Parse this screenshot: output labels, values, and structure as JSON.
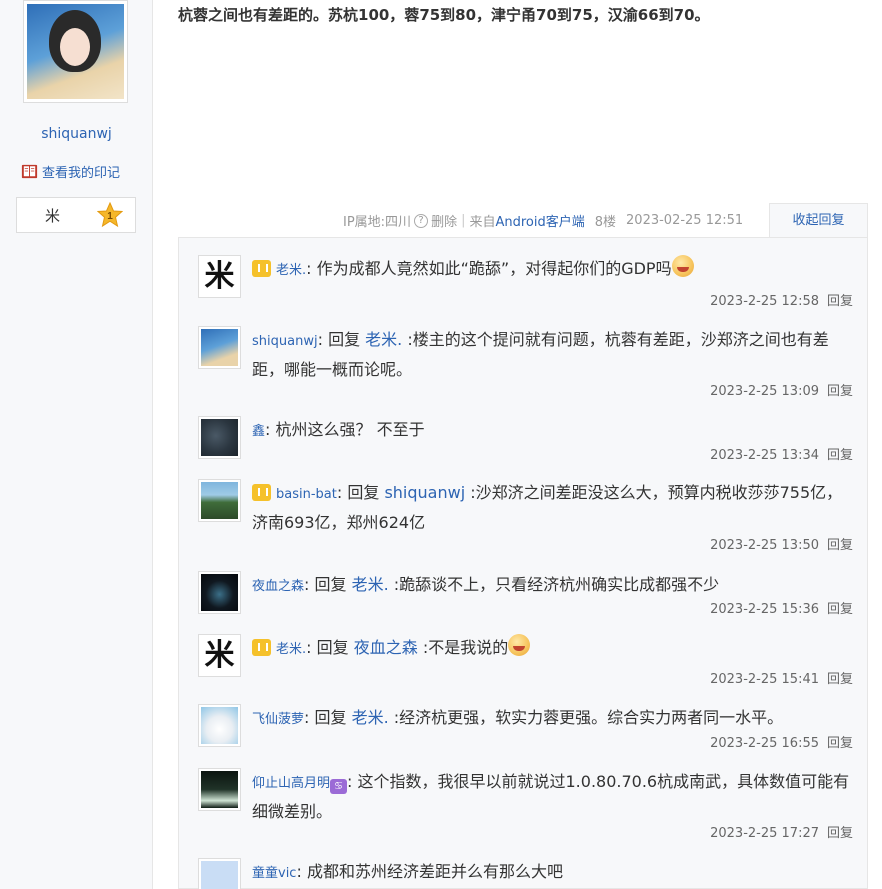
{
  "post": {
    "text": "杭蓉之间也有差距的。苏杭100，蓉75到80，津宁甬70到75，汉渝66到70。"
  },
  "author": {
    "name": "shiquanwj",
    "mark_link": "查看我的印记",
    "badge_text": "米",
    "badge_level": "1"
  },
  "meta": {
    "ip": "IP属地:四川",
    "delete": "删除",
    "from": "来自Android客户端",
    "floor": "8楼",
    "time": "2023-02-25 12:51",
    "collapse": "收起回复"
  },
  "reply_label": "回复",
  "replies": [
    {
      "user": "老米.",
      "avatar": "米",
      "vip": true,
      "text": "作为成都人竟然如此“跪舔”，对得起你们的GDP吗",
      "emoji": true,
      "time": "2023-2-25 12:58"
    },
    {
      "user": "shiquanwj",
      "prefix": "回复",
      "target": "老米.",
      "text": ":楼主的这个提问就有问题，杭蓉有差距，沙郑济之间也有差距，哪能一概而论呢。",
      "time": "2023-2-25 13:09"
    },
    {
      "user": "鑫",
      "text": "杭州这么强？ 不至于",
      "time": "2023-2-25 13:34"
    },
    {
      "user": "basin-bat",
      "vip": true,
      "prefix": "回复",
      "target": "shiquanwj",
      "text": ":沙郑济之间差距没这么大，预算内税收莎莎755亿，济南693亿，郑州624亿",
      "time": "2023-2-25 13:50"
    },
    {
      "user": "夜血之森",
      "prefix": "回复",
      "target": "老米.",
      "text": ":跪舔谈不上，只看经济杭州确实比成都强不少",
      "time": "2023-2-25 15:36"
    },
    {
      "user": "老米.",
      "avatar": "米",
      "vip": true,
      "prefix": "回复",
      "target": "夜血之森",
      "text": ":不是我说的",
      "emoji": true,
      "time": "2023-2-25 15:41"
    },
    {
      "user": "飞仙菠萝",
      "prefix": "回复",
      "target": "老米.",
      "text": ":经济杭更强，软实力蓉更强。综合实力两者同一水平。",
      "time": "2023-2-25 16:55"
    },
    {
      "user": "仰止山高月明",
      "zodiac": "♋",
      "text": "这个指数，我很早以前就说过1.0.80.70.6杭成南武，具体数值可能有细微差别。",
      "time": "2023-2-25 17:27"
    },
    {
      "user": "童童vic",
      "text": "成都和苏州经济差距并么有那么大吧"
    }
  ]
}
